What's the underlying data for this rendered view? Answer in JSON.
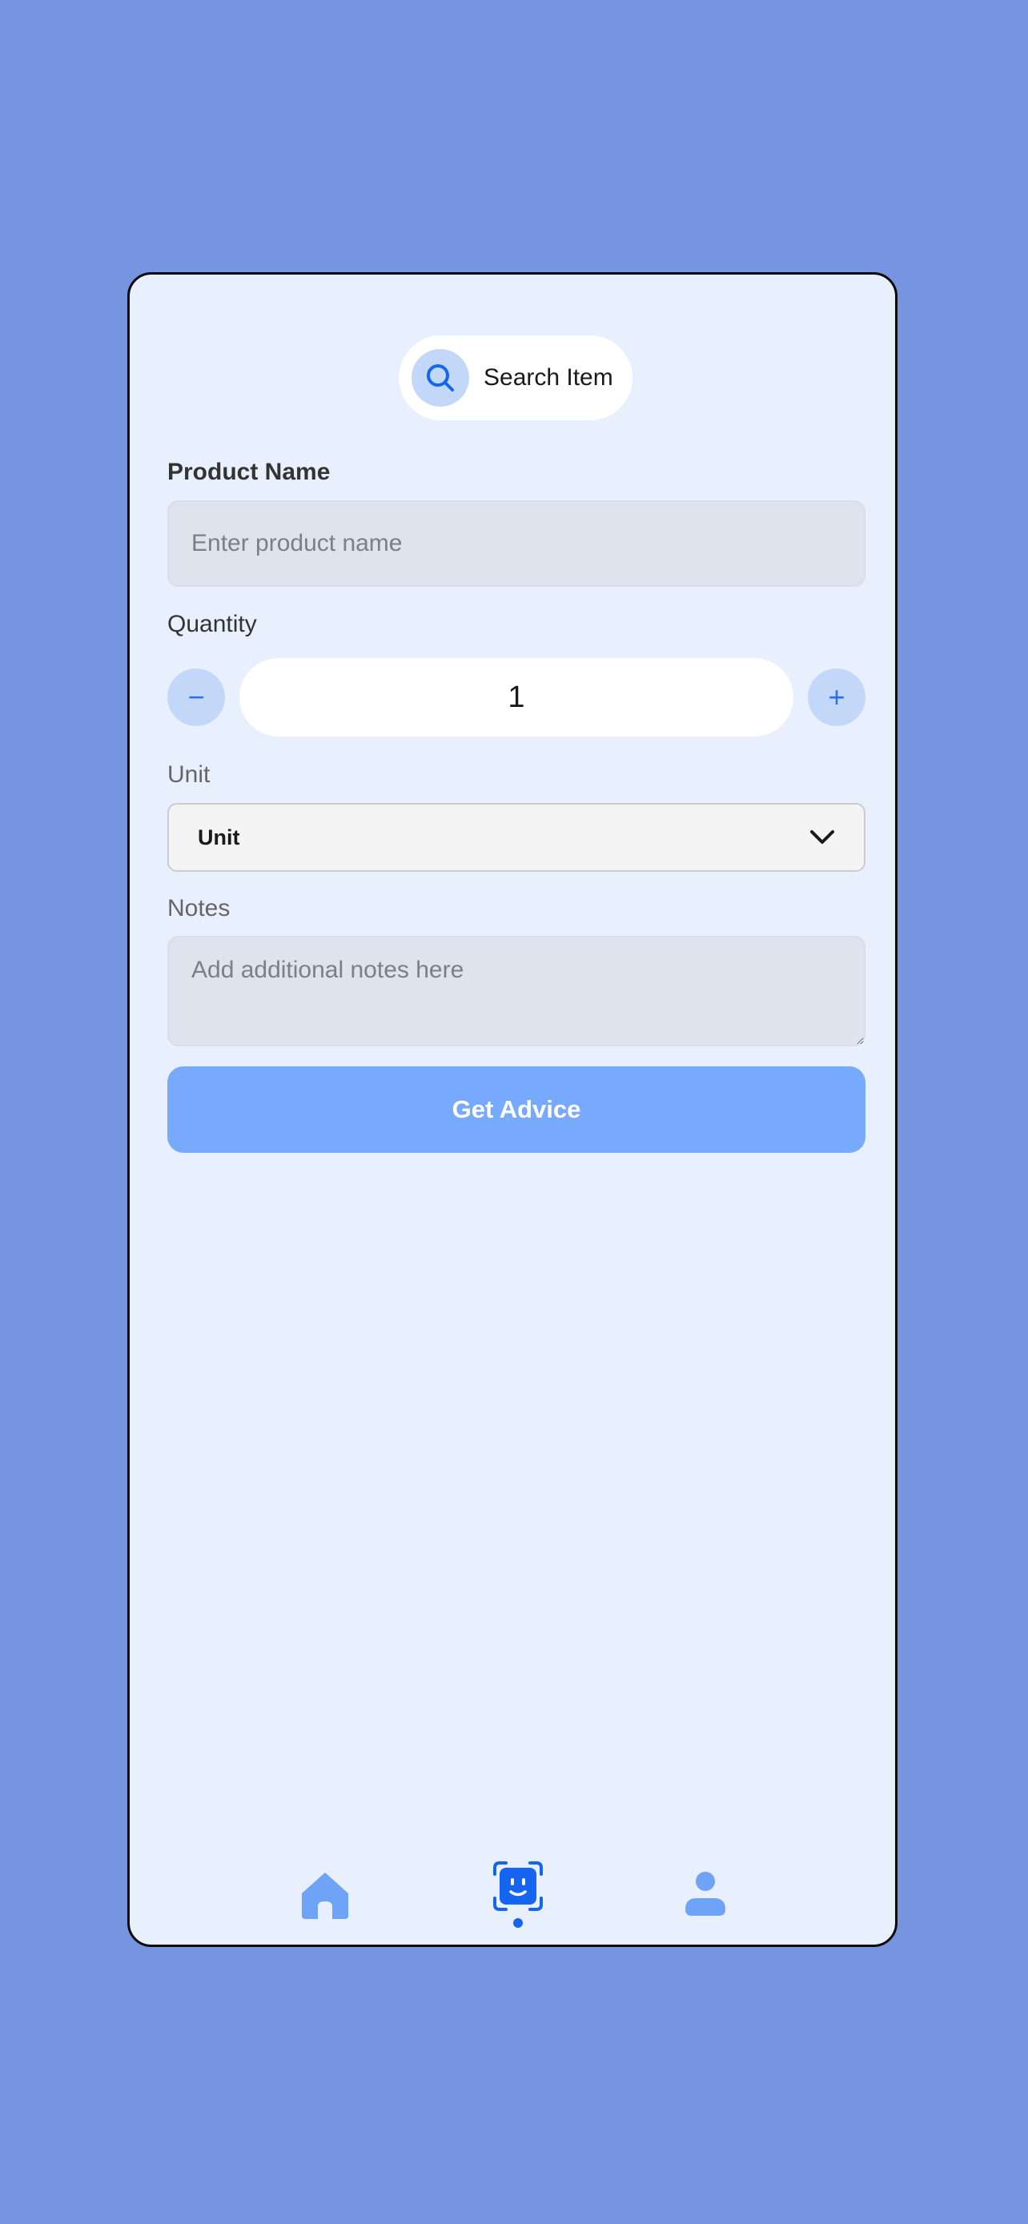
{
  "search": {
    "label": "Search Item",
    "icon": "search-icon"
  },
  "form": {
    "product_name": {
      "label": "Product Name",
      "placeholder": "Enter product name",
      "value": ""
    },
    "quantity": {
      "label": "Quantity",
      "value": "1",
      "decrement_symbol": "−",
      "increment_symbol": "+"
    },
    "unit": {
      "label": "Unit",
      "selected": "Unit"
    },
    "notes": {
      "label": "Notes",
      "placeholder": "Add additional notes here",
      "value": ""
    },
    "submit_label": "Get Advice"
  },
  "bottom_nav": {
    "items": [
      {
        "name": "home",
        "icon": "home-icon",
        "active": false
      },
      {
        "name": "scan",
        "icon": "face-scan-icon",
        "active": true
      },
      {
        "name": "profile",
        "icon": "user-icon",
        "active": false
      }
    ]
  },
  "colors": {
    "page_background": "#7794e0",
    "card_background": "#e8f0fd",
    "accent": "#1565f0",
    "accent_light": "#c3d7f8",
    "button": "#77aafc",
    "input_background": "#dee3ee"
  }
}
